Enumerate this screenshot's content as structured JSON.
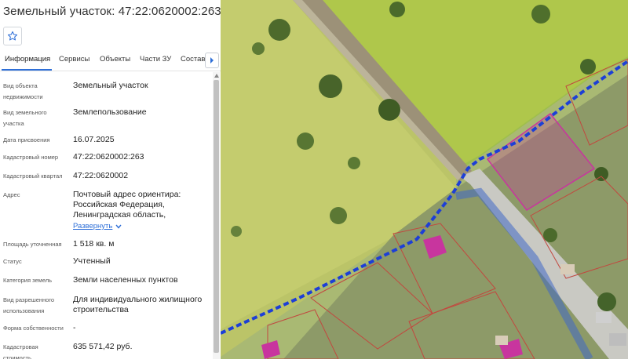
{
  "panel": {
    "title": "Земельный участок: 47:22:0620002:263",
    "tabs": [
      "Информация",
      "Сервисы",
      "Объекты",
      "Части ЗУ",
      "Состав"
    ],
    "properties": [
      {
        "label": "Вид объекта недвижимости",
        "value": "Земельный участок"
      },
      {
        "label": "Вид земельного участка",
        "value": "Землепользование"
      },
      {
        "label": "Дата присвоения",
        "value": "16.07.2025"
      },
      {
        "label": "Кадастровый номер",
        "value": "47:22:0620002:263"
      },
      {
        "label": "Кадастровый квартал",
        "value": "47:22:0620002"
      },
      {
        "label": "Адрес",
        "value": "Почтовый адрес ориентира: Российская Федерация, Ленинградская область,"
      },
      {
        "label": "Площадь уточненная",
        "value": "1 518 кв. м"
      },
      {
        "label": "Статус",
        "value": "Учтенный"
      },
      {
        "label": "Категория земель",
        "value": "Земли населенных пунктов"
      },
      {
        "label": "Вид разрешенного использования",
        "value": "Для индивидуального жилищного строительства"
      },
      {
        "label": "Форма собственности",
        "value": "-"
      },
      {
        "label": "Кадастровая стоимость",
        "value": "635 571,42 руб."
      }
    ],
    "expand_label": "Развернуть"
  },
  "colors": {
    "accent": "#2e6fd8",
    "boundary_dashed": "#1d3fd6",
    "parcel_selected": "#c8359e",
    "parcel_border": "#c2483f",
    "highlight_yellow": "#e8e24a"
  },
  "map": {
    "type": "satellite cadastral map"
  }
}
